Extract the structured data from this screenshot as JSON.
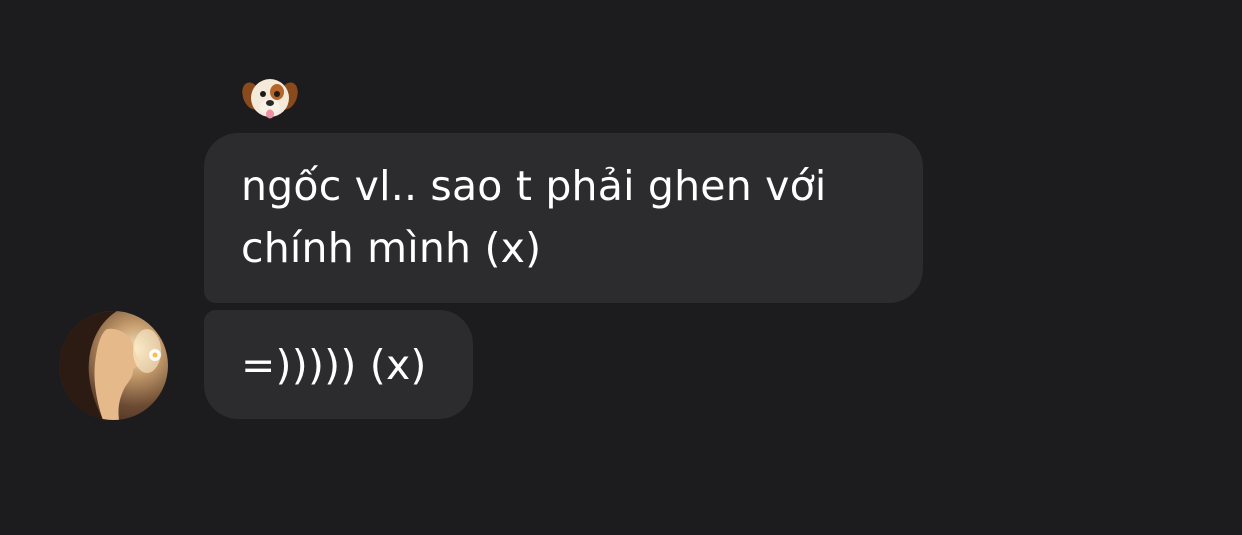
{
  "conversation": {
    "messages": [
      {
        "text": "ngốc vl.. sao t phải ghen với chính mình (x)",
        "reaction_icon": "dog-face-icon"
      },
      {
        "text": "=))))) (x)",
        "sender_avatar_icon": "avatar-photo"
      }
    ]
  },
  "theme": {
    "background": "#1c1c1e",
    "bubble_color": "#2c2c2e",
    "text_color": "#ffffff"
  }
}
